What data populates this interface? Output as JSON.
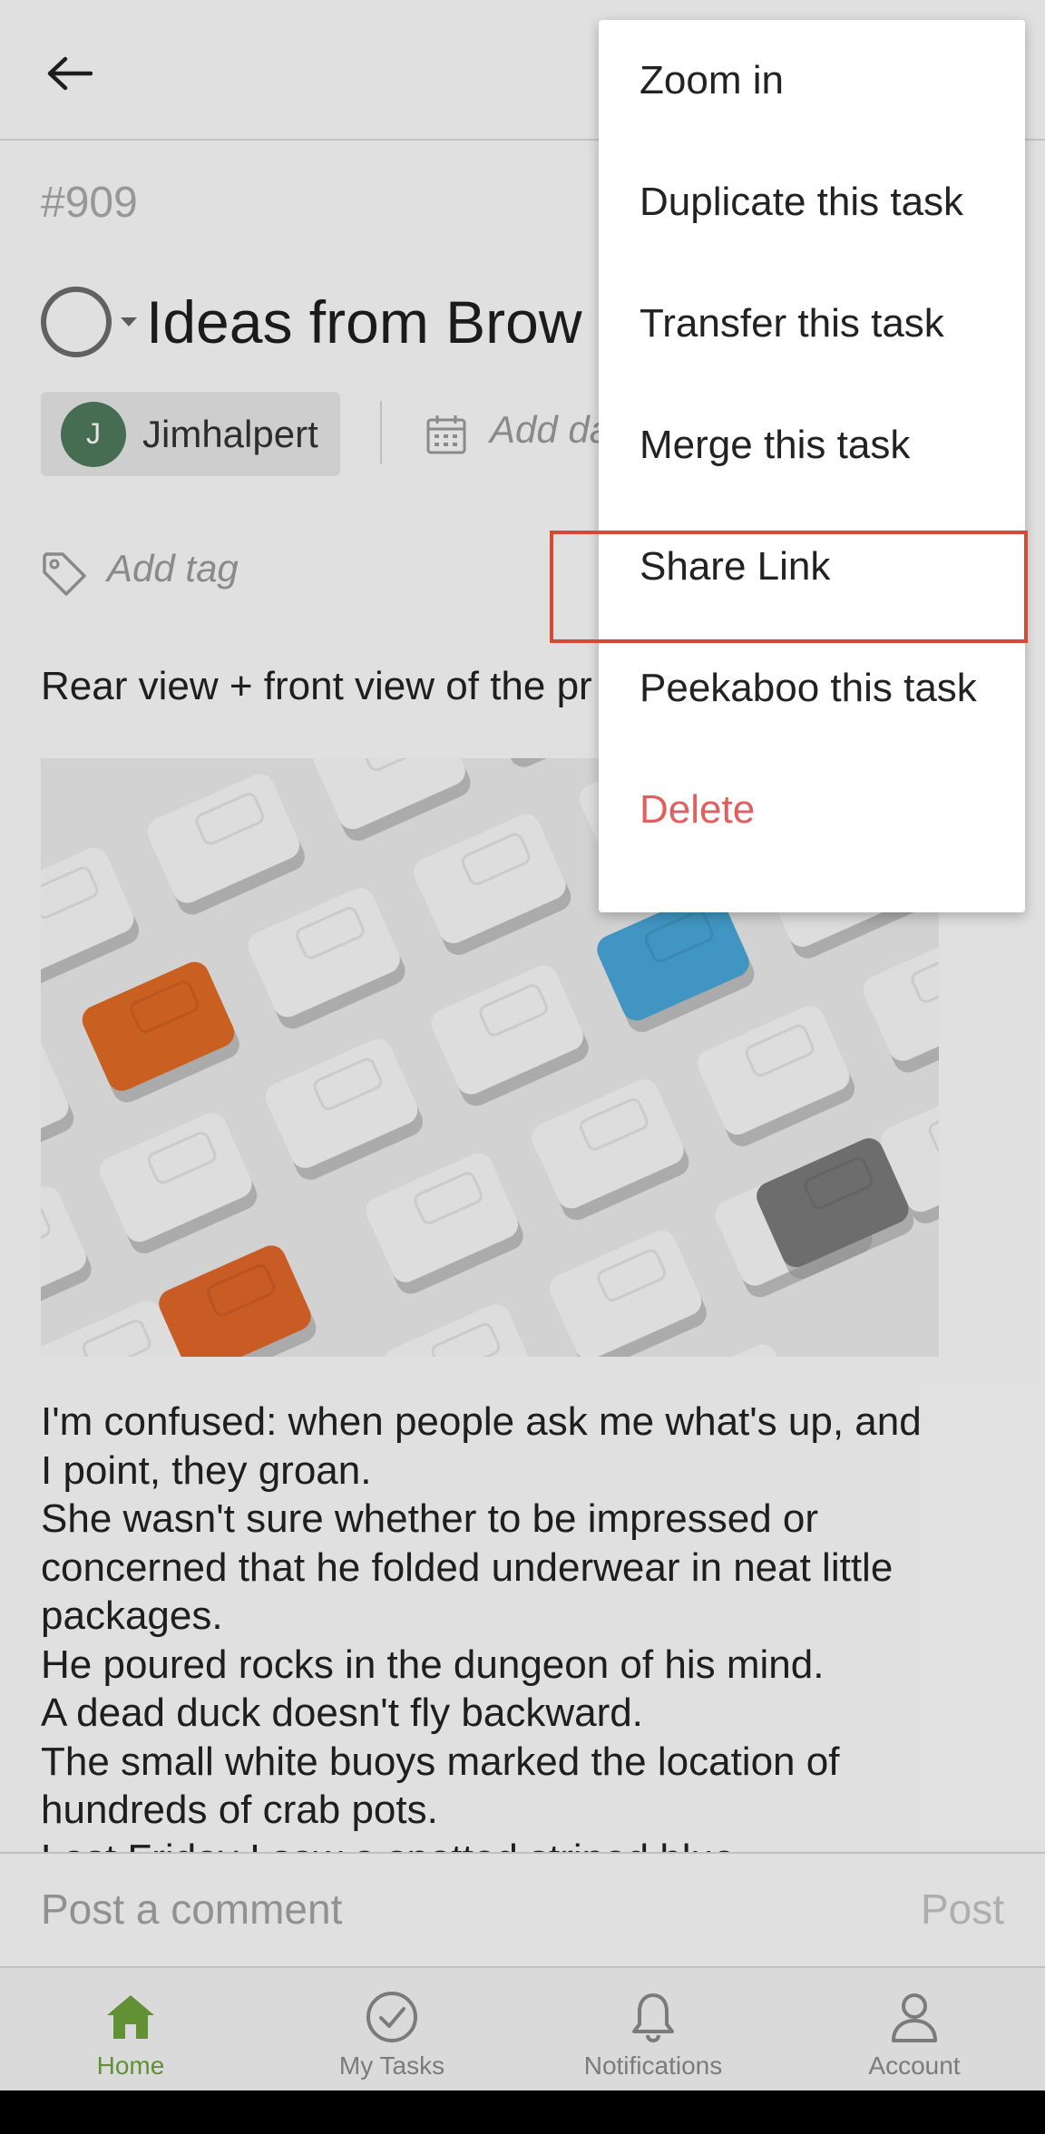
{
  "header": {
    "back_label": "Back"
  },
  "task": {
    "id": "#909",
    "title": "Ideas from Brow",
    "assignee": {
      "initial": "J",
      "name": "Jimhalpert"
    },
    "add_date_placeholder": "Add da",
    "add_tag_placeholder": "Add tag",
    "description_first_line": "Rear view + front view of the pr",
    "description_lines": [
      "I'm confused: when people ask me what's up, and",
      "I point, they groan.",
      "She wasn't sure whether to be impressed or",
      "concerned that he folded underwear in neat little",
      "packages.",
      "He poured rocks in the dungeon of his mind.",
      "A dead duck doesn't fly backward.",
      "The small white buoys marked the location of",
      "hundreds of crab pots.",
      "Last Friday I saw a spotted striped blue"
    ]
  },
  "comment": {
    "placeholder": "Post a comment",
    "post_label": "Post"
  },
  "menu": {
    "items": [
      {
        "label": "Zoom in"
      },
      {
        "label": "Duplicate this task"
      },
      {
        "label": "Transfer this task"
      },
      {
        "label": "Merge this task"
      },
      {
        "label": "Share Link"
      },
      {
        "label": "Peekaboo this task"
      },
      {
        "label": "Delete"
      }
    ]
  },
  "nav": {
    "items": [
      {
        "label": "Home",
        "icon": "home-icon",
        "active": true
      },
      {
        "label": "My Tasks",
        "icon": "check-circle-icon",
        "active": false
      },
      {
        "label": "Notifications",
        "icon": "bell-icon",
        "active": false
      },
      {
        "label": "Account",
        "icon": "person-icon",
        "active": false
      }
    ]
  },
  "colors": {
    "accent_green": "#6ea23c",
    "delete_red": "#e06060",
    "highlight_border": "#d54a35",
    "avatar_bg": "#4e7a5c"
  }
}
